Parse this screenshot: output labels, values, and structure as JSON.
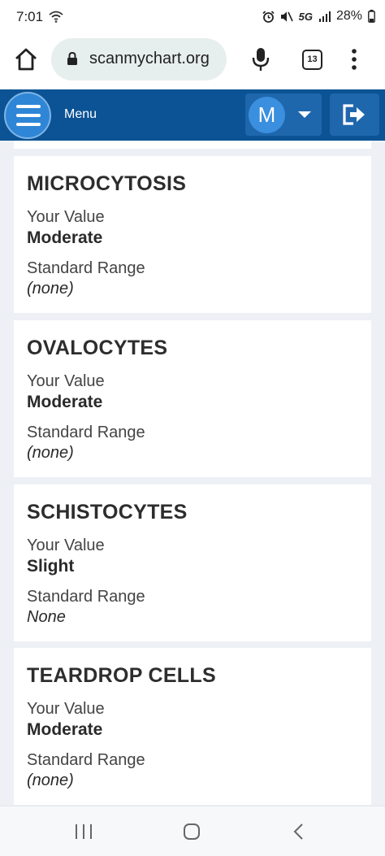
{
  "status_bar": {
    "time": "7:01",
    "network": "5G",
    "battery": "28%",
    "icons": [
      "wifi-icon",
      "alarm-icon",
      "mute-icon",
      "signal-icon",
      "battery-icon"
    ]
  },
  "browser": {
    "url": "scanmychart.org",
    "tab_count": "13",
    "icons": [
      "home-icon",
      "lock-icon",
      "mic-icon",
      "tabs-icon",
      "more-vert-icon"
    ]
  },
  "app_nav": {
    "menu_label": "Menu",
    "avatar_initial": "M",
    "color": "#0b5394",
    "icons": [
      "hamburger-icon",
      "caret-down-icon",
      "logout-icon"
    ]
  },
  "results": [
    {
      "name": "MICROCYTOSIS",
      "value_label": "Your Value",
      "value": "Moderate",
      "range_label": "Standard Range",
      "range": "(none)"
    },
    {
      "name": "OVALOCYTES",
      "value_label": "Your Value",
      "value": "Moderate",
      "range_label": "Standard Range",
      "range": "(none)"
    },
    {
      "name": "SCHISTOCYTES",
      "value_label": "Your Value",
      "value": "Slight",
      "range_label": "Standard Range",
      "range": "None"
    },
    {
      "name": "TEARDROP CELLS",
      "value_label": "Your Value",
      "value": "Moderate",
      "range_label": "Standard Range",
      "range": "(none)"
    }
  ],
  "system_nav": {
    "icons": [
      "recents-icon",
      "home-circle-icon",
      "back-icon"
    ]
  }
}
